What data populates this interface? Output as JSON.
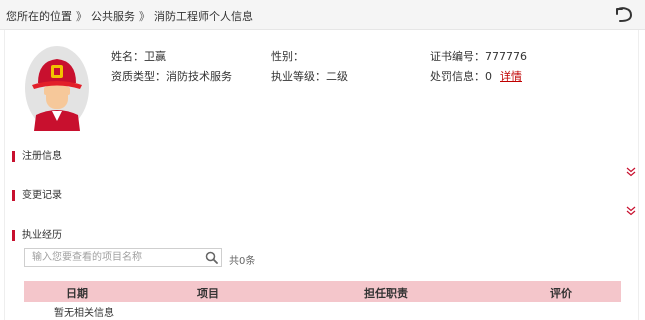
{
  "breadcrumb": {
    "prefix": "您所在的位置",
    "sep": "》",
    "items": [
      "公共服务",
      "消防工程师个人信息"
    ]
  },
  "profile": {
    "name": "姓名：卫赢",
    "gender": "性别：",
    "cert_no": "证书编号：777776",
    "qualification": "资质类型：消防技术服务",
    "level": "执业等级：二级",
    "penalty": "处罚信息：0",
    "detail_link": "详情"
  },
  "sections": {
    "registration": "注册信息",
    "changes": "变更记录",
    "practice": "执业经历"
  },
  "search": {
    "placeholder": "输入您要查看的项目名称",
    "count": "共0条"
  },
  "table": {
    "columns": [
      "日期",
      "项目",
      "担任职责",
      "评价"
    ],
    "empty": "暂无相关信息"
  },
  "colors": {
    "accent": "#c8102e",
    "header_bg": "#f4c6cb",
    "link": "#c00000"
  }
}
